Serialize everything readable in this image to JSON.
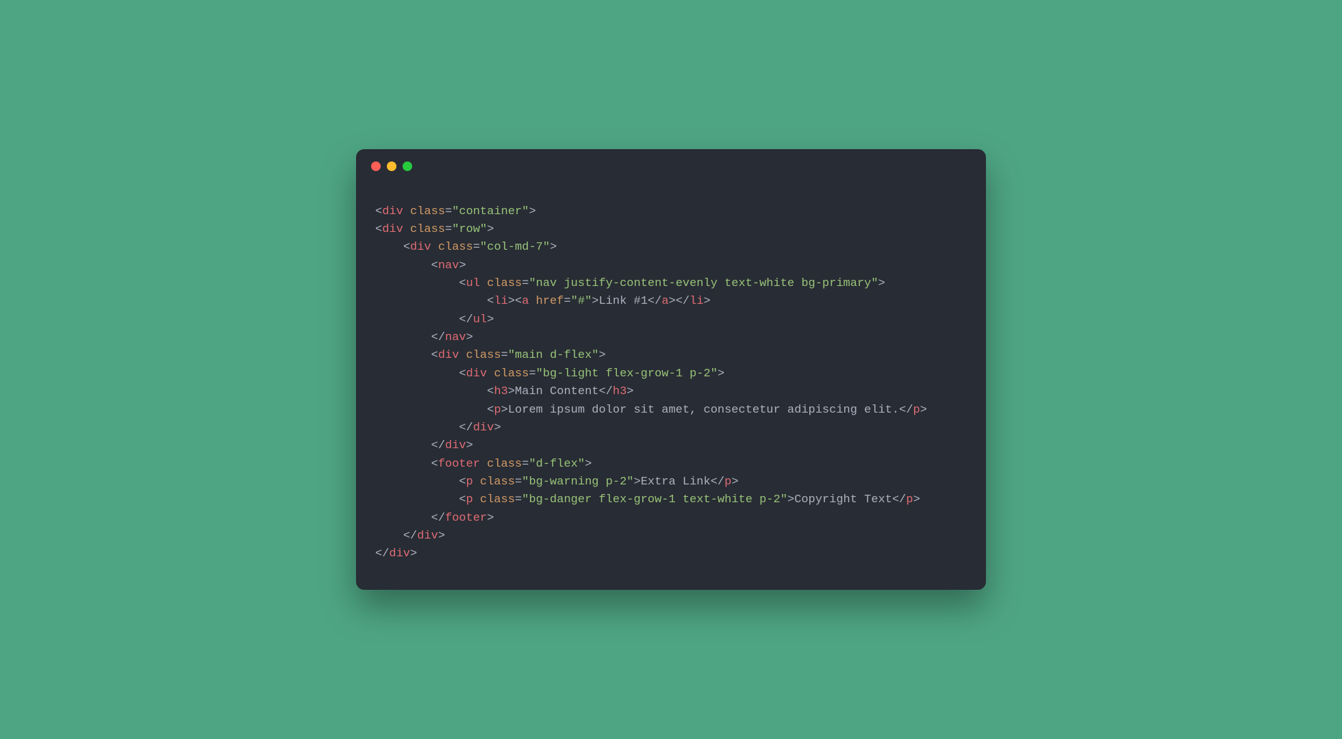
{
  "colors": {
    "background": "#4ea584",
    "editor_bg": "#282c34",
    "punctuation": "#abb2bf",
    "tag": "#e06c75",
    "attr": "#d19a66",
    "string": "#98c379",
    "text": "#abb2bf",
    "dot_red": "#ff5f56",
    "dot_yellow": "#ffbd2e",
    "dot_green": "#27c93f"
  },
  "code": {
    "l01": {
      "tag": "div",
      "attr": "class",
      "str": "\"container\""
    },
    "l02": {
      "tag": "div",
      "attr": "class",
      "str": "\"row\""
    },
    "l03": {
      "tag": "div",
      "attr": "class",
      "str": "\"col-md-7\""
    },
    "l04": {
      "tag": "nav"
    },
    "l05": {
      "tag": "ul",
      "attr": "class",
      "str": "\"nav justify-content-evenly text-white bg-primary\""
    },
    "l06": {
      "tag_li": "li",
      "tag_a": "a",
      "attr": "href",
      "str": "\"#\"",
      "text": "Link #1"
    },
    "l07": {
      "tag": "ul"
    },
    "l08": {
      "tag": "nav"
    },
    "l09": {
      "tag": "div",
      "attr": "class",
      "str": "\"main d-flex\""
    },
    "l10": {
      "tag": "div",
      "attr": "class",
      "str": "\"bg-light flex-grow-1 p-2\""
    },
    "l11": {
      "tag": "h3",
      "text": "Main Content"
    },
    "l12": {
      "tag": "p",
      "text": "Lorem ipsum dolor sit amet, consectetur adipiscing elit."
    },
    "l13": {
      "tag": "div"
    },
    "l14": {
      "tag": "div"
    },
    "l15": {
      "tag": "footer",
      "attr": "class",
      "str": "\"d-flex\""
    },
    "l16": {
      "tag": "p",
      "attr": "class",
      "str": "\"bg-warning p-2\"",
      "text": "Extra Link"
    },
    "l17": {
      "tag": "p",
      "attr": "class",
      "str": "\"bg-danger flex-grow-1 text-white p-2\"",
      "text": "Copyright Text"
    },
    "l18": {
      "tag": "footer"
    },
    "l19": {
      "tag": "div"
    },
    "l20": {
      "tag": "div"
    }
  }
}
